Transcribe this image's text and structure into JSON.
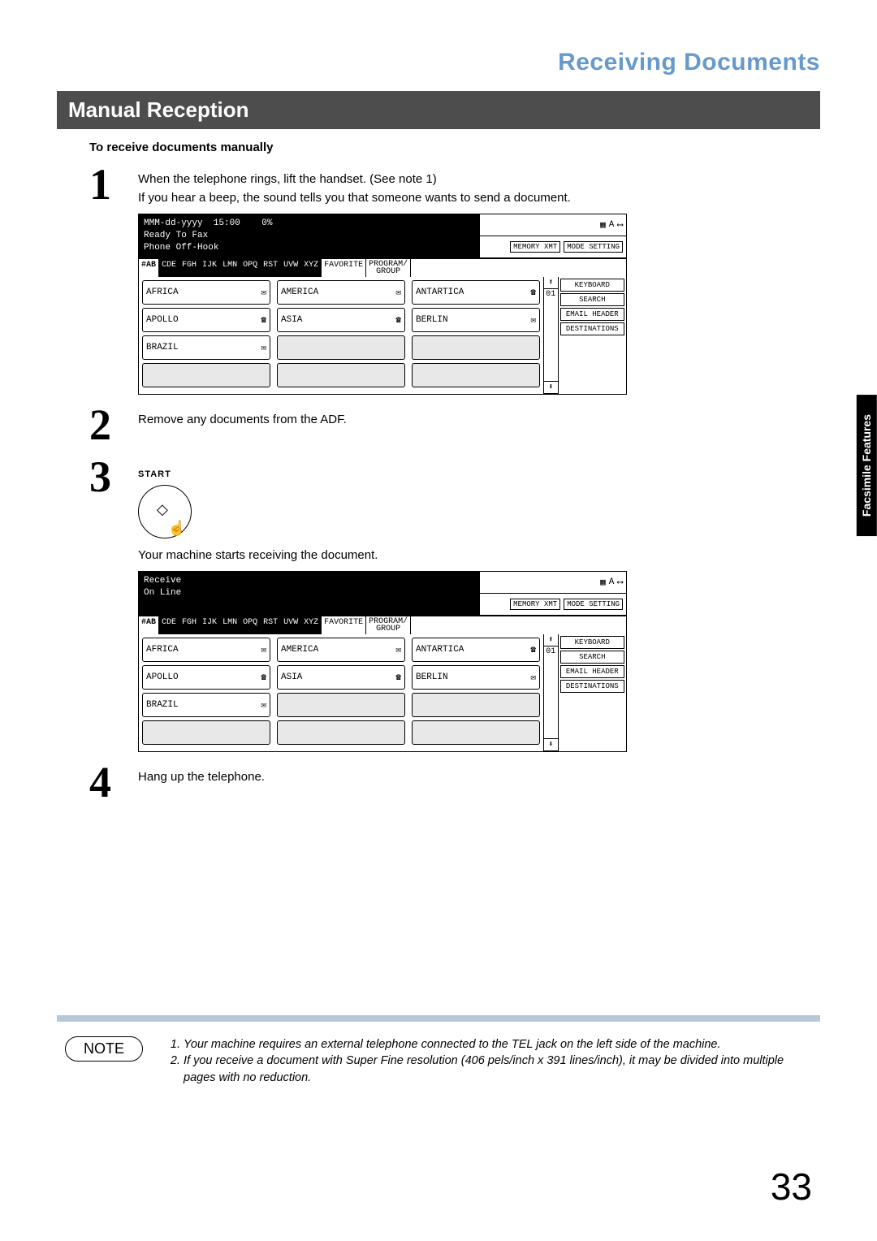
{
  "chapter_title": "Receiving Documents",
  "section_title": "Manual Reception",
  "subheading": "To receive documents manually",
  "side_tab": "Facsimile\nFeatures",
  "steps": {
    "s1": {
      "num": "1",
      "text": "When the telephone rings, lift the handset. (See note 1)\nIf you hear a beep, the sound tells you that someone wants to send a document."
    },
    "s2": {
      "num": "2",
      "text": "Remove any documents from the ADF."
    },
    "s3": {
      "num": "3",
      "start_label": "START",
      "text": "Your machine starts receiving the document."
    },
    "s4": {
      "num": "4",
      "text": "Hang up the telephone."
    }
  },
  "panel1": {
    "status": "MMM-dd-yyyy  15:00    0%\nReady To Fax\nPhone Off-Hook",
    "topbtn1": "MEMORY XMT",
    "topbtn2": "MODE SETTING",
    "tabs": [
      "#AB",
      "CDE",
      "FGH",
      "IJK",
      "LMN",
      "OPQ",
      "RST",
      "UVW",
      "XYZ",
      "FAVORITE",
      "PROGRAM/\nGROUP"
    ],
    "cells": [
      [
        "AFRICA",
        "AMERICA",
        "ANTARTICA"
      ],
      [
        "APOLLO",
        "ASIA",
        "BERLIN"
      ],
      [
        "BRAZIL",
        "",
        ""
      ]
    ],
    "side": [
      "KEYBOARD",
      "SEARCH",
      "EMAIL HEADER",
      "DESTINATIONS"
    ],
    "counter": "01"
  },
  "panel2": {
    "status": "Receive\nOn Line",
    "topbtn1": "MEMORY XMT",
    "topbtn2": "MODE SETTING",
    "tabs": [
      "#AB",
      "CDE",
      "FGH",
      "IJK",
      "LMN",
      "OPQ",
      "RST",
      "UVW",
      "XYZ",
      "FAVORITE",
      "PROGRAM/\nGROUP"
    ],
    "cells": [
      [
        "AFRICA",
        "AMERICA",
        "ANTARTICA"
      ],
      [
        "APOLLO",
        "ASIA",
        "BERLIN"
      ],
      [
        "BRAZIL",
        "",
        ""
      ]
    ],
    "side": [
      "KEYBOARD",
      "SEARCH",
      "EMAIL HEADER",
      "DESTINATIONS"
    ],
    "counter": "01"
  },
  "note_label": "NOTE",
  "notes": {
    "n1": "Your machine requires an external telephone connected to the TEL jack on the left side of the machine.",
    "n2": "If you receive a document with Super Fine resolution (406 pels/inch x 391 lines/inch), it may be divided into multiple pages with no reduction."
  },
  "page_number": "33",
  "icons": {
    "mail": "✉",
    "phone": "☎",
    "up": "⬆",
    "down": "⬇",
    "grid": "▦",
    "a": "A",
    "slider": "⟷"
  }
}
